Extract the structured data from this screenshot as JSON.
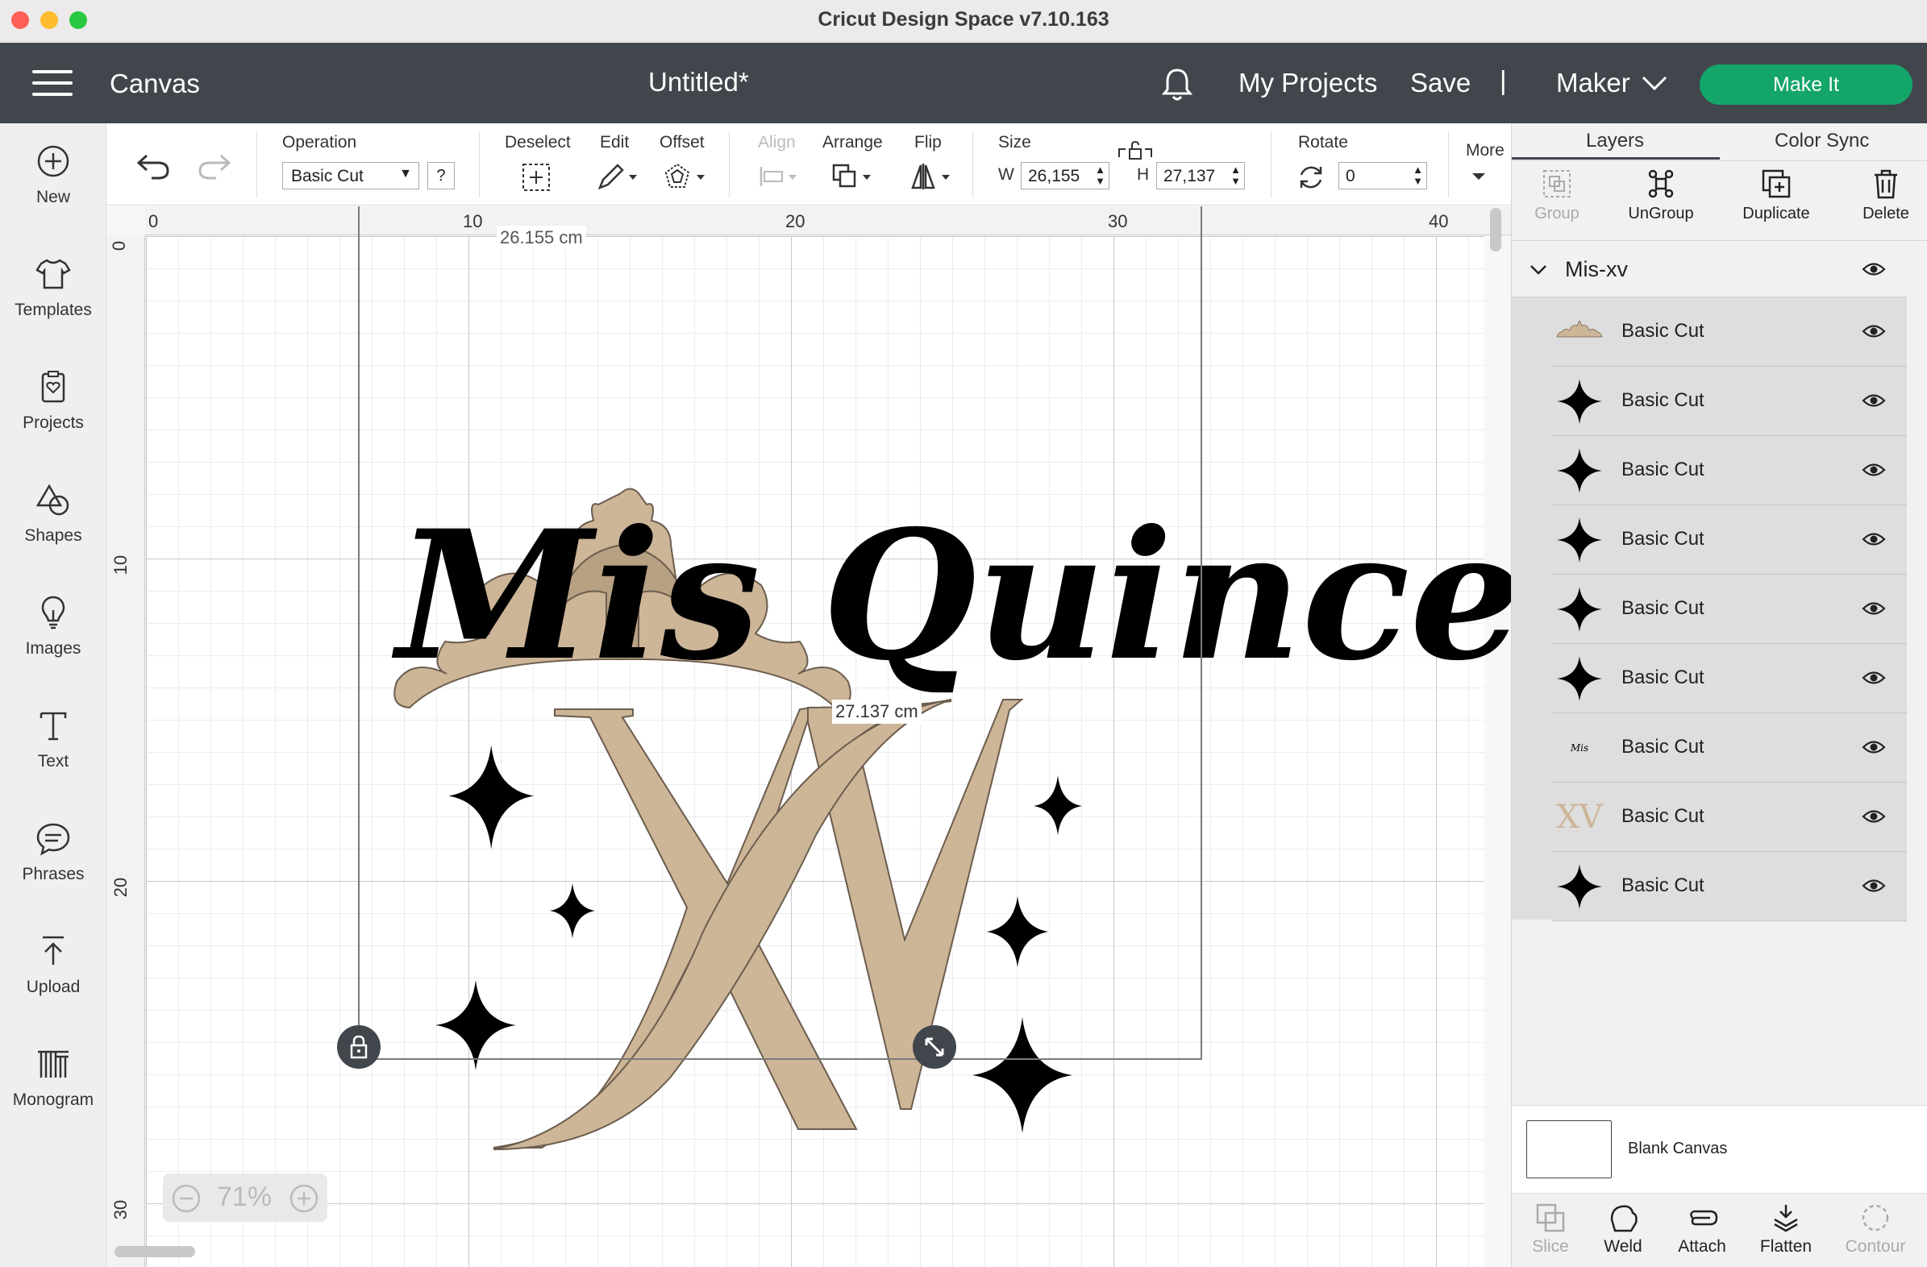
{
  "window": {
    "title": "Cricut Design Space  v7.10.163"
  },
  "header": {
    "section": "Canvas",
    "doc_title": "Untitled*",
    "my_projects": "My Projects",
    "save": "Save",
    "separator": "|",
    "machine": "Maker",
    "make_it": "Make It"
  },
  "sidebar": {
    "items": [
      {
        "label": "New",
        "icon": "plus-circle-icon"
      },
      {
        "label": "Templates",
        "icon": "tshirt-icon"
      },
      {
        "label": "Projects",
        "icon": "clipboard-heart-icon"
      },
      {
        "label": "Shapes",
        "icon": "shapes-icon"
      },
      {
        "label": "Images",
        "icon": "lightbulb-icon"
      },
      {
        "label": "Text",
        "icon": "text-icon"
      },
      {
        "label": "Phrases",
        "icon": "speech-bubble-icon"
      },
      {
        "label": "Upload",
        "icon": "upload-icon"
      },
      {
        "label": "Monogram",
        "icon": "monogram-icon"
      }
    ]
  },
  "toolbar": {
    "operation_label": "Operation",
    "operation_value": "Basic Cut",
    "help": "?",
    "deselect": "Deselect",
    "edit": "Edit",
    "offset": "Offset",
    "align": "Align",
    "arrange": "Arrange",
    "flip": "Flip",
    "size": "Size",
    "w_label": "W",
    "w_value": "26,155",
    "h_label": "H",
    "h_value": "27,137",
    "rotate": "Rotate",
    "rotate_value": "0",
    "more": "More"
  },
  "canvas": {
    "ruler_top": [
      "0",
      "10",
      "20",
      "30",
      "40"
    ],
    "ruler_left": [
      "0",
      "10",
      "20",
      "30"
    ],
    "width_dim": "26.155 cm",
    "height_dim": "27.137 cm",
    "zoom": "71%",
    "design_text": "Mis Quince",
    "monogram_text": "XV",
    "colors": {
      "gold": "#cdb598",
      "black": "#000000"
    }
  },
  "panel": {
    "tabs": [
      "Layers",
      "Color Sync"
    ],
    "actions": [
      {
        "label": "Group",
        "enabled": false
      },
      {
        "label": "UnGroup",
        "enabled": true
      },
      {
        "label": "Duplicate",
        "enabled": true
      },
      {
        "label": "Delete",
        "enabled": true
      }
    ],
    "group_name": "Mis-xv",
    "layers": [
      {
        "name": "Basic Cut",
        "thumb": "crown"
      },
      {
        "name": "Basic Cut",
        "thumb": "star"
      },
      {
        "name": "Basic Cut",
        "thumb": "star"
      },
      {
        "name": "Basic Cut",
        "thumb": "star"
      },
      {
        "name": "Basic Cut",
        "thumb": "star"
      },
      {
        "name": "Basic Cut",
        "thumb": "star"
      },
      {
        "name": "Basic Cut",
        "thumb": "text",
        "thumb_text": "Mis Quince"
      },
      {
        "name": "Basic Cut",
        "thumb": "xv",
        "thumb_text": "XV"
      },
      {
        "name": "Basic Cut",
        "thumb": "star"
      }
    ],
    "blank_canvas": "Blank Canvas",
    "bottom_actions": [
      {
        "label": "Slice",
        "enabled": false
      },
      {
        "label": "Weld",
        "enabled": true
      },
      {
        "label": "Attach",
        "enabled": true
      },
      {
        "label": "Flatten",
        "enabled": true
      },
      {
        "label": "Contour",
        "enabled": false
      }
    ]
  }
}
